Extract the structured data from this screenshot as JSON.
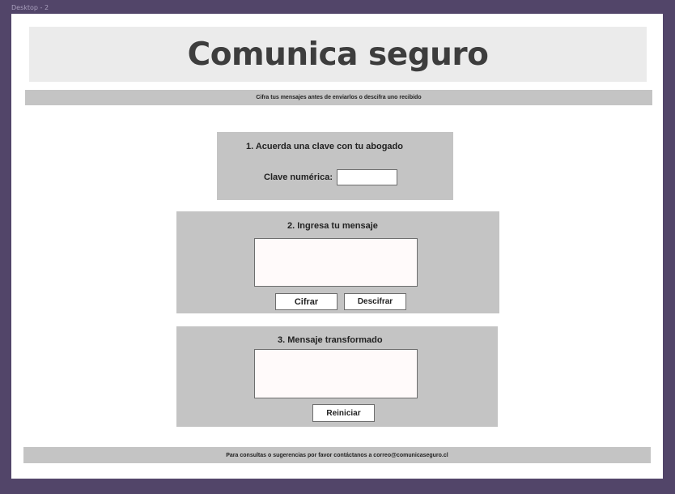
{
  "frame": {
    "label": "Desktop - 2"
  },
  "header": {
    "title": "Comunica seguro",
    "subtitle": "Cifra tus mensajes antes de enviarlos o descifra uno recibido"
  },
  "step1": {
    "title": "1. Acuerda una clave con tu abogado",
    "key_label": "Clave numérica:",
    "key_value": "",
    "key_placeholder": ""
  },
  "step2": {
    "title": "2. Ingresa tu mensaje",
    "message_value": "",
    "encrypt_label": "Cifrar",
    "decrypt_label": "Descifrar"
  },
  "step3": {
    "title": "3. Mensaje transformado",
    "result_value": "",
    "reset_label": "Reiniciar"
  },
  "footer": {
    "text": "Para consultas o sugerencias por favor contáctanos a correo@comunicaseguro.cl"
  },
  "colors": {
    "frame_background": "#524569",
    "canvas_background": "#ffffff",
    "banner_background": "#ebebeb",
    "panel_background": "#c4c4c4",
    "title_text": "#3d3d3d"
  }
}
